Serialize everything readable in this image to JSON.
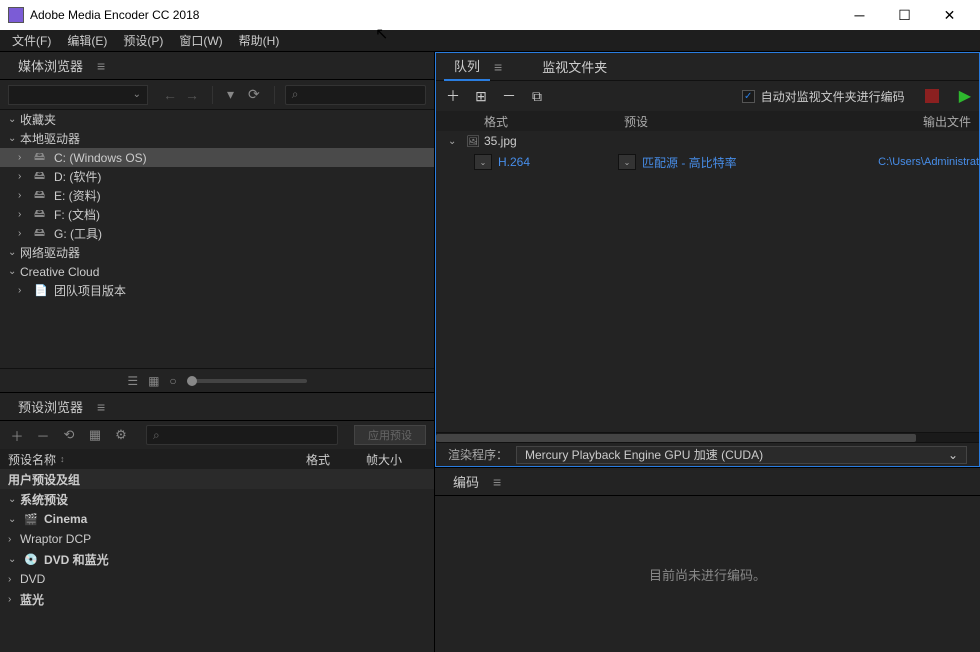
{
  "titlebar": {
    "title": "Adobe Media Encoder CC 2018"
  },
  "menubar": {
    "file": "文件(F)",
    "edit": "编辑(E)",
    "preset": "预设(P)",
    "window": "窗口(W)",
    "help": "帮助(H)"
  },
  "media_browser": {
    "title": "媒体浏览器",
    "tree": {
      "favorites": "收藏夹",
      "local_drives": "本地驱动器",
      "drive_c": "C: (Windows OS)",
      "drive_d": "D: (软件)",
      "drive_e": "E: (资料)",
      "drive_f": "F: (文档)",
      "drive_g": "G: (工具)",
      "network_drives": "网络驱动器",
      "creative_cloud": "Creative Cloud",
      "team_project": "团队项目版本"
    }
  },
  "preset_browser": {
    "title": "预设浏览器",
    "apply": "应用预设",
    "col_name": "预设名称",
    "col_format": "格式",
    "col_framesize": "帧大小",
    "user_presets": "用户预设及组",
    "system_presets": "系统预设",
    "cinema": "Cinema",
    "wraptor": "Wraptor DCP",
    "dvd_bluray": "DVD 和蓝光",
    "dvd": "DVD",
    "bluray": "蓝光"
  },
  "queue": {
    "tab_queue": "队列",
    "tab_watch": "监视文件夹",
    "auto_encode": "自动对监视文件夹进行编码",
    "col_format": "格式",
    "col_preset": "预设",
    "col_output": "输出文件",
    "file_name": "35.jpg",
    "row_format": "H.264",
    "row_preset": "匹配源 - 高比特率",
    "row_output": "C:\\Users\\Administrat",
    "renderer_label": "渲染程序：",
    "renderer_value": "Mercury Playback Engine GPU 加速 (CUDA)"
  },
  "encoding": {
    "title": "编码",
    "status": "目前尚未进行编码。"
  }
}
